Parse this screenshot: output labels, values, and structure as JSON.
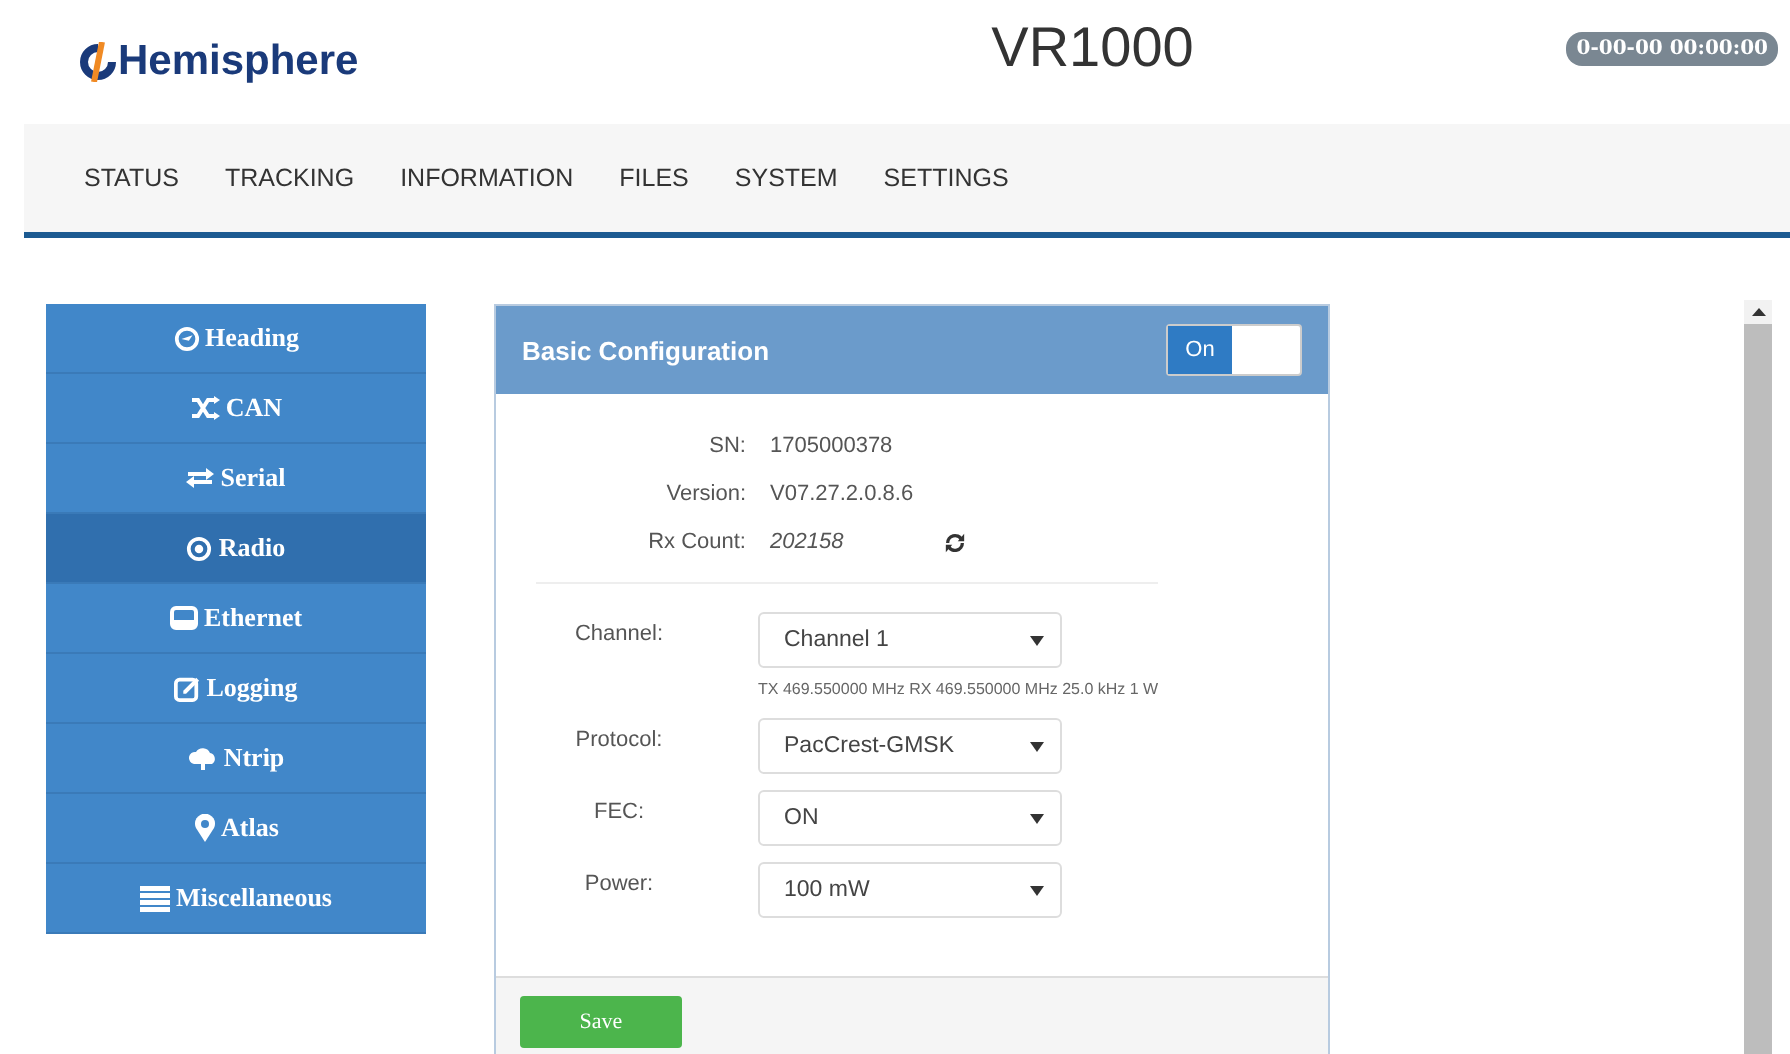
{
  "header": {
    "logo": "Hemisphere",
    "title": "VR1000",
    "timestamp": "0-00-00 00:00:00"
  },
  "nav": [
    {
      "label": "STATUS"
    },
    {
      "label": "TRACKING"
    },
    {
      "label": "INFORMATION"
    },
    {
      "label": "FILES"
    },
    {
      "label": "SYSTEM"
    },
    {
      "label": "SETTINGS"
    }
  ],
  "sidebar": {
    "items": [
      {
        "label": "Heading",
        "selected": false
      },
      {
        "label": "CAN",
        "selected": false
      },
      {
        "label": "Serial",
        "selected": false
      },
      {
        "label": "Radio",
        "selected": true
      },
      {
        "label": "Ethernet",
        "selected": false
      },
      {
        "label": "Logging",
        "selected": false
      },
      {
        "label": "Ntrip",
        "selected": false
      },
      {
        "label": "Atlas",
        "selected": false
      },
      {
        "label": "Miscellaneous",
        "selected": false
      }
    ]
  },
  "panel": {
    "title": "Basic Configuration",
    "switch": {
      "label": "On",
      "on": true
    },
    "info": [
      {
        "label": "SN:",
        "value": "1705000378"
      },
      {
        "label": "Version:",
        "value": "V07.27.2.0.8.6"
      },
      {
        "label": "Rx Count:",
        "value": "202158",
        "refresh": true
      }
    ],
    "fields": [
      {
        "label": "Channel:",
        "value": "Channel 1",
        "hint": "TX 469.550000 MHz RX 469.550000 MHz 25.0 kHz 1 W"
      },
      {
        "label": "Protocol:",
        "value": "PacCrest-GMSK"
      },
      {
        "label": "FEC:",
        "value": "ON"
      },
      {
        "label": "Power:",
        "value": "100 mW"
      }
    ],
    "save": "Save"
  }
}
